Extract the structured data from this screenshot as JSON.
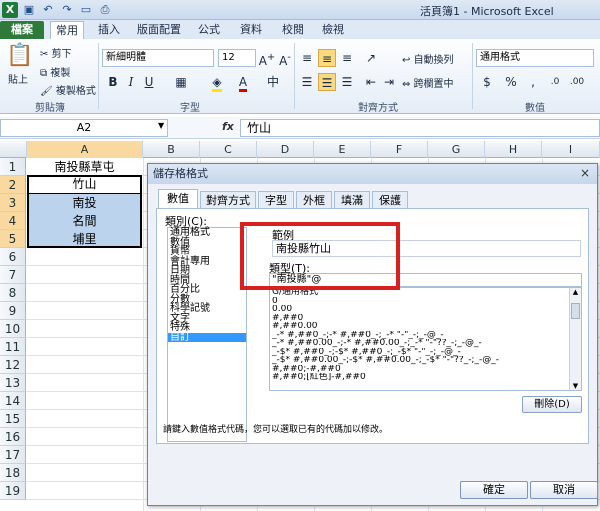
{
  "window": {
    "title": "活頁簿1 - Microsoft Excel"
  },
  "ribbon_tabs": [
    "檔案",
    "常用",
    "插入",
    "版面配置",
    "公式",
    "資料",
    "校閱",
    "檢視"
  ],
  "ribbon": {
    "clipboard": {
      "label": "剪貼簿",
      "paste": "貼上",
      "cut": "剪下",
      "copy": "複製",
      "format_painter": "複製格式"
    },
    "font": {
      "label": "字型",
      "name": "新細明體",
      "size": "12"
    },
    "alignment": {
      "label": "對齊方式",
      "wrap": "自動換列",
      "merge": "跨欄置中"
    },
    "number": {
      "label": "數值",
      "format": "通用格式"
    }
  },
  "formula_bar": {
    "name_box": "A2",
    "fx": "fx",
    "value": "竹山"
  },
  "grid": {
    "columns": [
      "A",
      "B",
      "C",
      "D",
      "E",
      "F",
      "G",
      "H",
      "I"
    ],
    "rows": [
      "1",
      "2",
      "3",
      "4",
      "5",
      "6",
      "7",
      "8",
      "9",
      "10",
      "11",
      "12",
      "13",
      "14",
      "15",
      "16",
      "17",
      "18",
      "19"
    ],
    "cells_a": [
      "南投縣草屯",
      "竹山",
      "南投",
      "名間",
      "埔里"
    ]
  },
  "dialog": {
    "title": "儲存格格式",
    "close": "×",
    "tabs": [
      "數值",
      "對齊方式",
      "字型",
      "外框",
      "填滿",
      "保護"
    ],
    "category_label": "類別(C):",
    "categories": [
      "通用格式",
      "數值",
      "貨幣",
      "會計專用",
      "日期",
      "時間",
      "百分比",
      "分數",
      "科學記號",
      "文字",
      "特殊",
      "自訂"
    ],
    "sample_label": "範例",
    "sample_value": "南投縣竹山",
    "type_label": "類型(T):",
    "type_value": "\"南投縣\"@",
    "formats": [
      "G/通用格式",
      "0",
      "0.00",
      "#,##0",
      "#,##0.00",
      "_-* #,##0_-;-* #,##0_-;_-* \"-\"_-;_-@_-",
      "_-* #,##0.00_-;-* #,##0.00_-;_-* \"-\"??_-;_-@_-",
      "_-$* #,##0_-;-$* #,##0_-;_-$* \"-\"_-;_-@_-",
      "_-$* #,##0.00_-;-$* #,##0.00_-;_-$* \"-\"??_-;_-@_-",
      "#,##0;-#,##0",
      "#,##0;[紅色]-#,##0"
    ],
    "delete_button": "刪除(D)",
    "hint": "請鍵入數值格式代碼，您可以選取已有的代碼加以修改。",
    "ok_button": "確定",
    "cancel_button": "取消"
  },
  "colors": {
    "file_tab": "#2f7a38",
    "selection": "#bcd3ee",
    "highlight": "#d9201e",
    "list_selection": "#3399ff"
  }
}
